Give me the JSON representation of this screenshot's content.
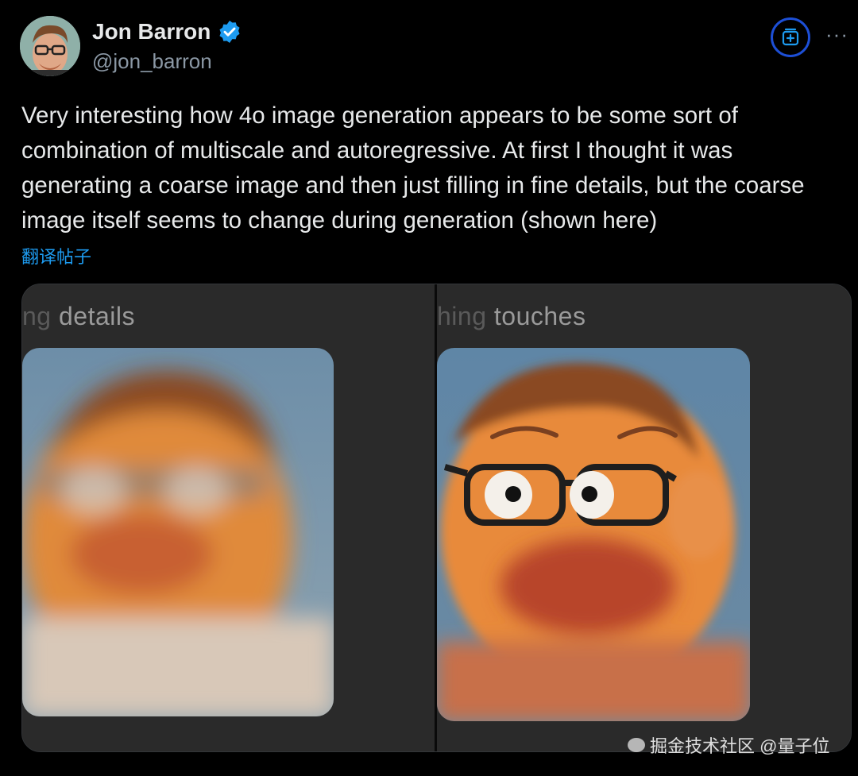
{
  "author": {
    "name": "Jon Barron",
    "handle": "@jon_barron",
    "verified": true,
    "accent": "#1d9bf0"
  },
  "actions": {
    "add_icon": "add-to-list-icon",
    "more_label": "···"
  },
  "tweet": {
    "text": "Very interesting how 4o image generation appears to be some sort of combination of multiscale and autoregressive. At first I thought it was generating a coarse image and then just filling in fine details, but the coarse image itself seems to change during generation (shown here)",
    "translate_label": "翻译帖子"
  },
  "media": {
    "left_caption_faded": "ng ",
    "left_caption": "details",
    "right_caption_faded": "hing ",
    "right_caption": "touches"
  },
  "watermark": "掘金技术社区 @量子位"
}
